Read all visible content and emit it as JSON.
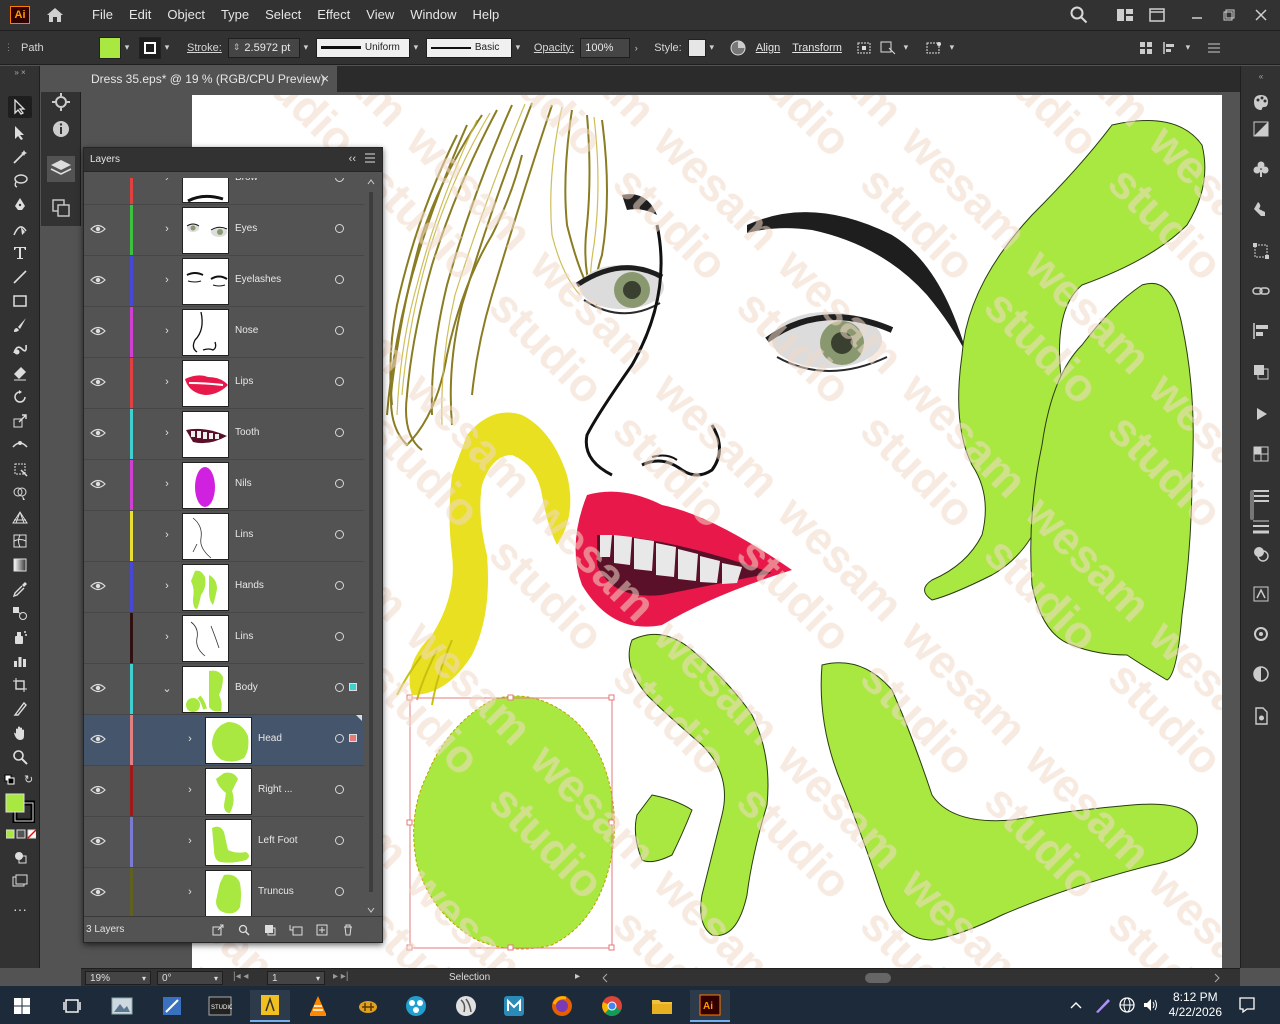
{
  "menu": {
    "items": [
      "File",
      "Edit",
      "Object",
      "Type",
      "Select",
      "Effect",
      "View",
      "Window",
      "Help"
    ],
    "logo": "Ai"
  },
  "control": {
    "selection_type": "Path",
    "fill_color": "#a8e840",
    "stroke_label": "Stroke:",
    "stroke_weight": "2.5972 pt",
    "profile_uniform": "Uniform",
    "brush_basic": "Basic",
    "opacity_label": "Opacity:",
    "opacity_value": "100%",
    "style_label": "Style:",
    "align": "Align",
    "transform": "Transform"
  },
  "document": {
    "tab_title": "Dress 35.eps* @ 19 % (RGB/CPU Preview)",
    "close": "×"
  },
  "layers_panel": {
    "title": "Layers",
    "collapse": "‹‹",
    "count": "3 Layers",
    "rows": [
      {
        "name": "Brow",
        "color": "#e04040",
        "visible": false,
        "level": 0,
        "expanded": false,
        "selected": false,
        "thumb": "brow"
      },
      {
        "name": "Eyes",
        "color": "#40c040",
        "visible": true,
        "level": 0,
        "expanded": false,
        "selected": false,
        "thumb": "eyes"
      },
      {
        "name": "Eyelashes",
        "color": "#4848d8",
        "visible": true,
        "level": 0,
        "expanded": false,
        "selected": false,
        "thumb": "eyelashes"
      },
      {
        "name": "Nose",
        "color": "#d040d0",
        "visible": true,
        "level": 0,
        "expanded": false,
        "selected": false,
        "thumb": "nose"
      },
      {
        "name": "Lips",
        "color": "#e04040",
        "visible": true,
        "level": 0,
        "expanded": false,
        "selected": false,
        "thumb": "lips"
      },
      {
        "name": "Tooth",
        "color": "#40d0d0",
        "visible": true,
        "level": 0,
        "expanded": false,
        "selected": false,
        "thumb": "tooth"
      },
      {
        "name": "Nils",
        "color": "#d040d0",
        "visible": true,
        "level": 0,
        "expanded": false,
        "selected": false,
        "thumb": "nils"
      },
      {
        "name": "Lins",
        "color": "#e8e030",
        "visible": false,
        "level": 0,
        "expanded": false,
        "selected": false,
        "thumb": "lins"
      },
      {
        "name": "Hands",
        "color": "#4848d8",
        "visible": true,
        "level": 0,
        "expanded": false,
        "selected": false,
        "thumb": "hands"
      },
      {
        "name": "Lins",
        "color": "#301010",
        "visible": false,
        "level": 0,
        "expanded": false,
        "selected": false,
        "thumb": "lins2"
      },
      {
        "name": "Body",
        "color": "#40d0d0",
        "visible": true,
        "level": 0,
        "expanded": true,
        "selected": false,
        "thumb": "body"
      },
      {
        "name": "Head",
        "color": "#e08080",
        "visible": true,
        "level": 1,
        "expanded": false,
        "selected": true,
        "thumb": "head"
      },
      {
        "name": "Right ...",
        "color": "#a01818",
        "visible": true,
        "level": 1,
        "expanded": false,
        "selected": false,
        "thumb": "right"
      },
      {
        "name": "Left Foot",
        "color": "#7a7ad0",
        "visible": true,
        "level": 1,
        "expanded": false,
        "selected": false,
        "thumb": "leftfoot"
      },
      {
        "name": "Truncus",
        "color": "#606020",
        "visible": true,
        "level": 1,
        "expanded": false,
        "selected": false,
        "thumb": "truncus"
      }
    ]
  },
  "status": {
    "zoom": "19%",
    "rotation": "0°",
    "artboard": "1",
    "tool": "Selection"
  },
  "taskbar": {
    "time": "8:12 PM",
    "date": "4/22/2026",
    "apps": [
      "task-view",
      "photos",
      "snipping",
      "studio",
      "paint",
      "vlc",
      "app-bee",
      "pinwheel",
      "app-g",
      "app-m",
      "firefox",
      "chrome",
      "explorer",
      "illustrator"
    ]
  },
  "colors": {
    "green_body": "#a8e840",
    "lips_red": "#e8194a",
    "hair_yellow": "#e8e020",
    "hair_olive": "#a89a30",
    "ui_dark": "#323232",
    "ui_mid": "#535353",
    "selection": "#45556b"
  }
}
